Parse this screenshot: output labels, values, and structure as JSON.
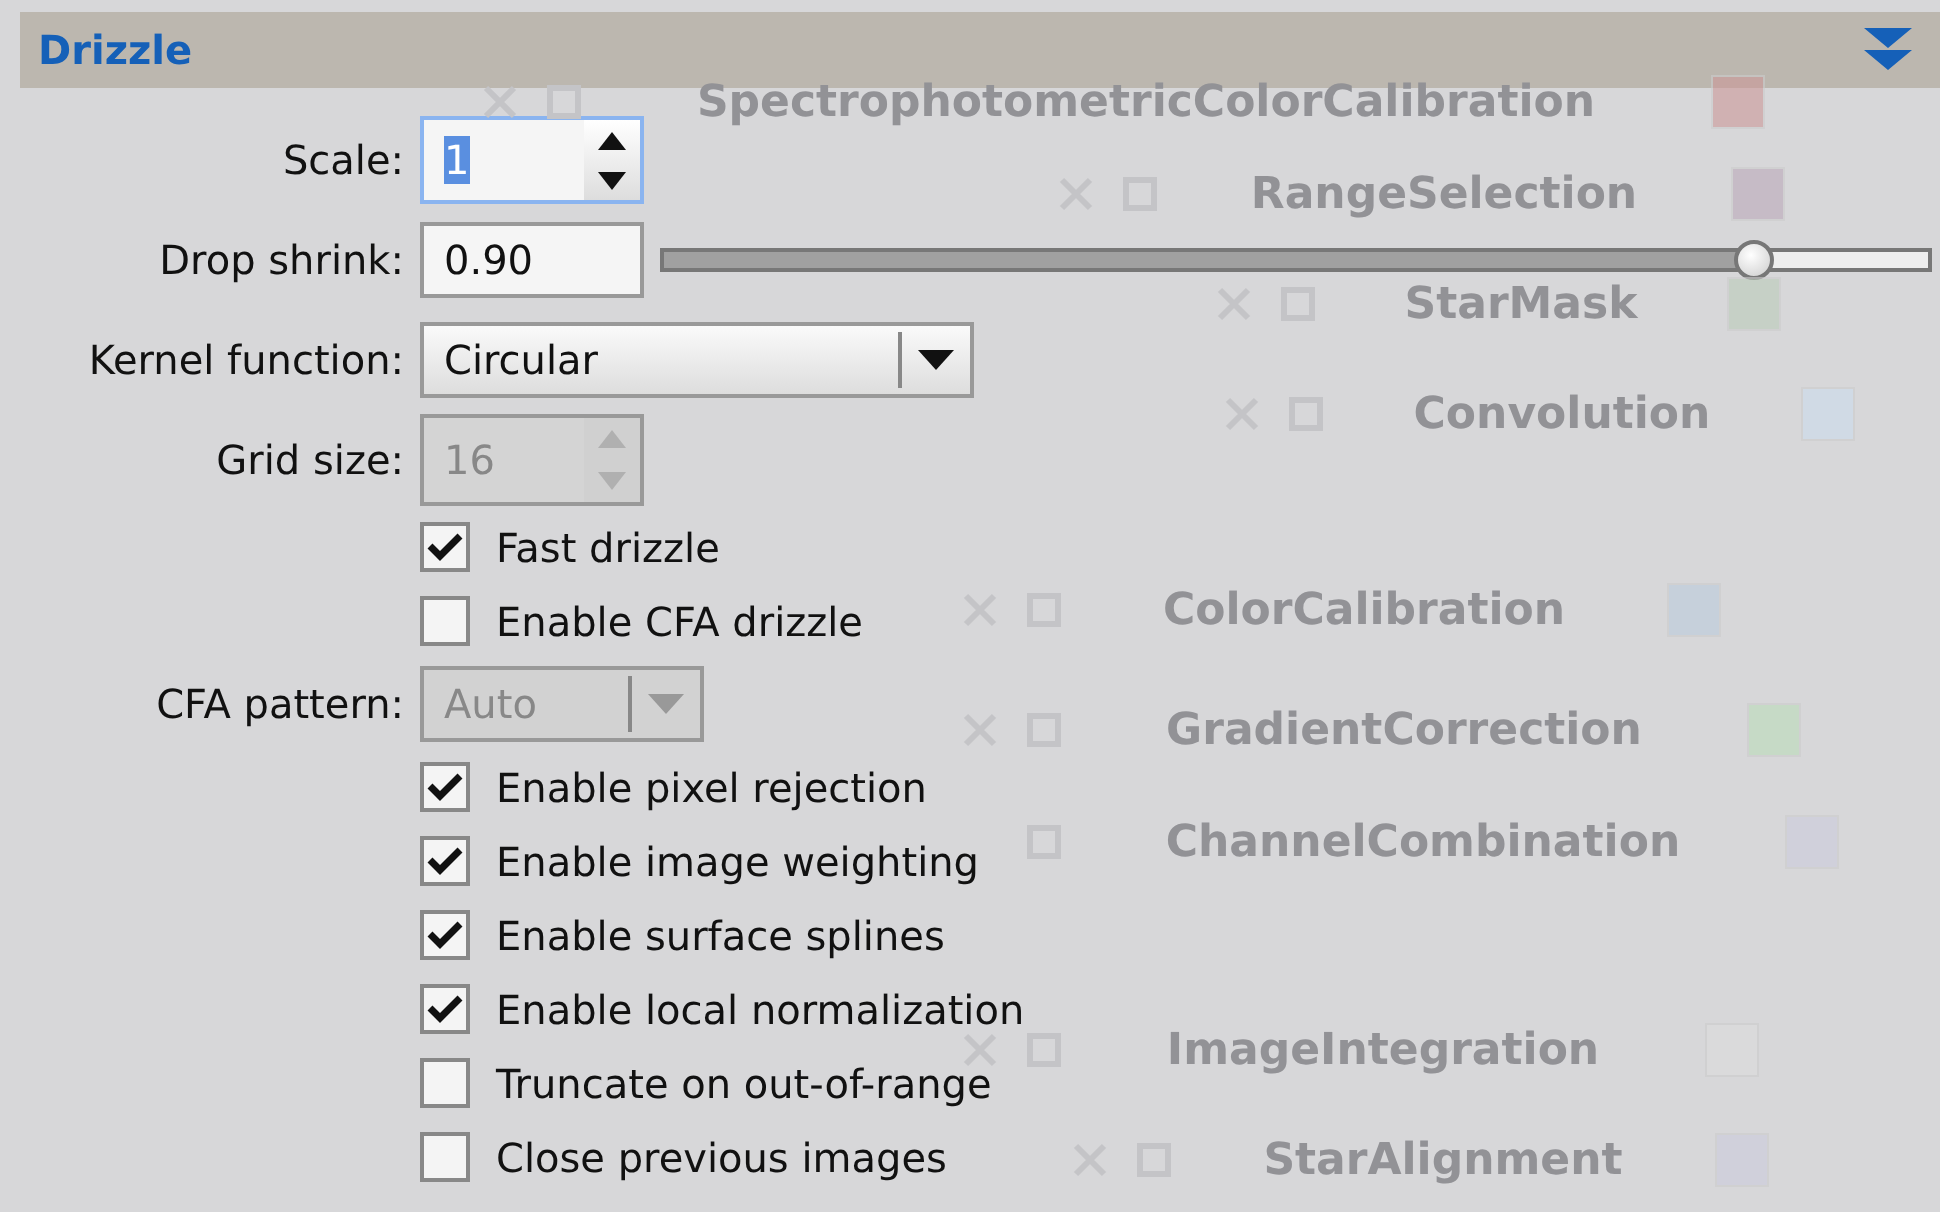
{
  "background_icons": [
    {
      "label": "SpectrophotometricColorCalibration"
    },
    {
      "label": "RangeSelection"
    },
    {
      "label": "StarMask"
    },
    {
      "label": "Convolution"
    },
    {
      "label": "ColorCalibration"
    },
    {
      "label": "GradientCorrection"
    },
    {
      "label": "ChannelCombination"
    },
    {
      "label": "ImageIntegration"
    },
    {
      "label": "StarAlignment"
    }
  ],
  "section": {
    "title": "Drizzle",
    "expanded": true
  },
  "rows": [
    {
      "kind": "spin",
      "label": "Scale:",
      "value": "1",
      "focused": true,
      "value_selected": true,
      "disabled": false
    },
    {
      "kind": "slider",
      "label": "Drop shrink:",
      "value": "0.90",
      "level": 0.86
    },
    {
      "kind": "combo",
      "label": "Kernel function:",
      "value": "Circular",
      "disabled": false
    },
    {
      "kind": "spin",
      "label": "Grid size:",
      "value": "16",
      "focused": false,
      "value_selected": false,
      "disabled": true
    },
    {
      "kind": "checkbox",
      "label": "Fast drizzle",
      "checked": true
    },
    {
      "kind": "checkbox",
      "label": "Enable CFA drizzle",
      "checked": false
    },
    {
      "kind": "combo",
      "label": "CFA pattern:",
      "value": "Auto",
      "disabled": true
    },
    {
      "kind": "checkbox",
      "label": "Enable pixel rejection",
      "checked": true
    },
    {
      "kind": "checkbox",
      "label": "Enable image weighting",
      "checked": true
    },
    {
      "kind": "checkbox",
      "label": "Enable surface splines",
      "checked": true
    },
    {
      "kind": "checkbox",
      "label": "Enable local normalization",
      "checked": true
    },
    {
      "kind": "checkbox",
      "label": "Truncate on out-of-range",
      "checked": false
    },
    {
      "kind": "checkbox",
      "label": "Close previous images",
      "checked": false
    }
  ]
}
